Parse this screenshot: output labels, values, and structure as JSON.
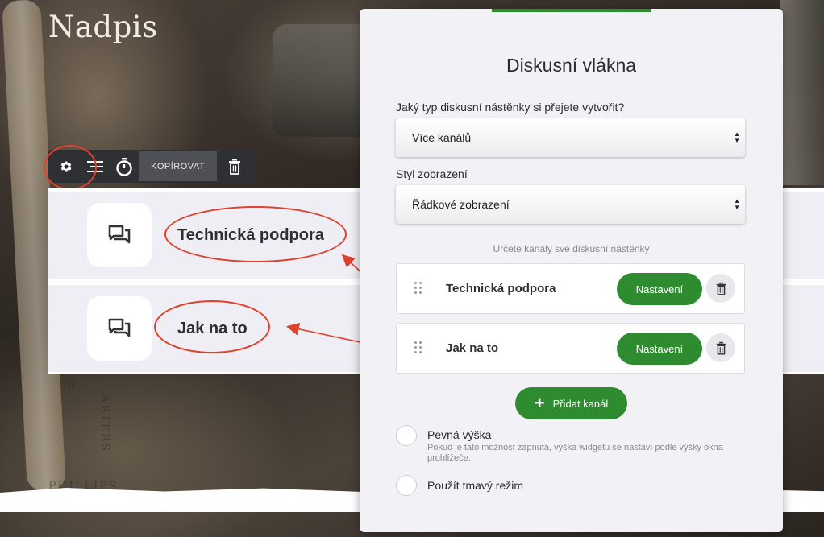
{
  "page": {
    "heading": "Nadpis"
  },
  "background_text": {
    "b1": "n",
    "b2": "ARTERS",
    "b3": "PHILLIPS"
  },
  "toolbar": {
    "settings_icon": "gear-icon",
    "layout_icon": "align-lines-icon",
    "timer_icon": "stopwatch-icon",
    "copy_label": "KOPÍROVAT",
    "delete_icon": "trash-icon"
  },
  "preview": {
    "channels": [
      {
        "label": "Technická podpora",
        "icon": "chat-icon"
      },
      {
        "label": "Jak na to",
        "icon": "chat-icon"
      }
    ]
  },
  "panel": {
    "title": "Diskusní vlákna",
    "board_type": {
      "label": "Jaký typ diskusní nástěnky si přejete vytvořit?",
      "value": "Více kanálů"
    },
    "display_style": {
      "label": "Styl zobrazení",
      "value": "Řádkové zobrazení"
    },
    "channels_hint": "Určete kanály své diskusní nástěnky",
    "channels": [
      {
        "name": "Technická podpora",
        "settings_label": "Nastavení"
      },
      {
        "name": "Jak na to",
        "settings_label": "Nastavení"
      }
    ],
    "add_channel_label": "Přidat kanál",
    "fixed_height": {
      "label": "Pevná výška",
      "description": "Pokud je tato možnost zapnutá, výška widgetu se nastaví podle výšky okna prohlížeče."
    },
    "dark_mode": {
      "label": "Použít tmavý režim"
    }
  },
  "colors": {
    "accent_green": "#2e8b2f",
    "annotation_red": "#e0412d",
    "panel_bg": "#f2f2f6"
  }
}
